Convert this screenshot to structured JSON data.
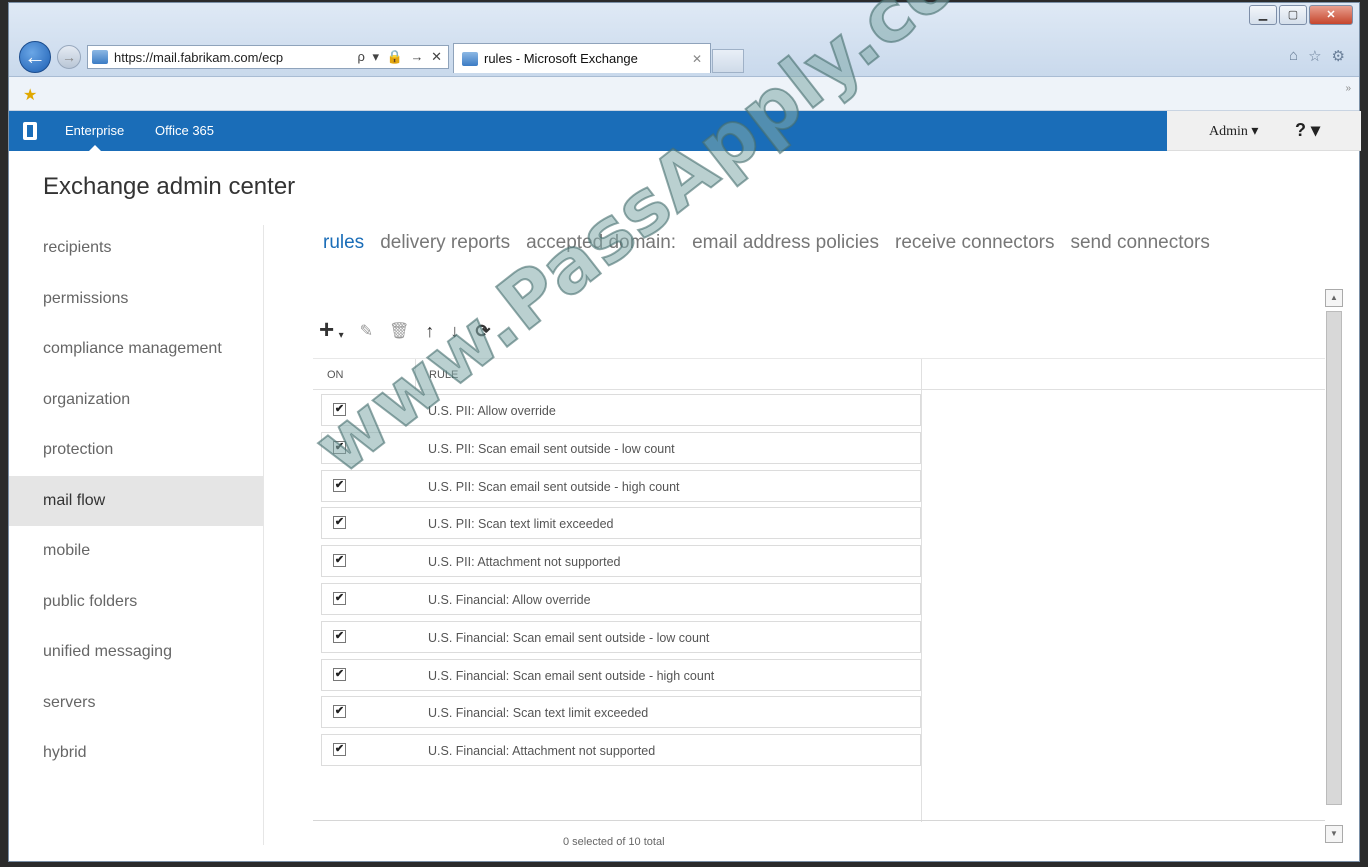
{
  "browser": {
    "url": "https://mail.fabrikam.com/ecp",
    "address_tools": "ρ ▾ 🔒 → ✕",
    "tab_title": "rules - Microsoft Exchange",
    "tab_close": "✕"
  },
  "window_controls": {
    "minimize": "▁",
    "maximize": "▢",
    "close": "✕"
  },
  "o365": {
    "links": [
      "Enterprise",
      "Office 365"
    ],
    "active": "Enterprise",
    "admin": "Admin ▾",
    "help": "? ▾"
  },
  "page_title": "Exchange admin center",
  "sidebar": {
    "items": [
      "recipients",
      "permissions",
      "compliance management",
      "organization",
      "protection",
      "mail flow",
      "mobile",
      "public folders",
      "unified messaging",
      "servers",
      "hybrid"
    ],
    "active": "mail flow"
  },
  "subtabs": {
    "items": [
      "rules",
      "delivery reports",
      "accepted domain:",
      "email address policies",
      "receive connectors",
      "send connectors"
    ],
    "active": "rules"
  },
  "toolbar": {
    "add": "+",
    "add_dropdown": "▾",
    "edit": "✎",
    "delete": "🗑",
    "move_up": "↑",
    "move_down": "↓",
    "refresh": "⟳"
  },
  "table": {
    "columns": [
      "ON",
      "RULE"
    ],
    "rows": [
      {
        "on": true,
        "rule": "U.S. PII: Allow override"
      },
      {
        "on": true,
        "rule": "U.S. PII: Scan email sent outside - low count"
      },
      {
        "on": true,
        "rule": "U.S. PII: Scan email sent outside - high count"
      },
      {
        "on": true,
        "rule": "U.S. PII: Scan text limit exceeded"
      },
      {
        "on": true,
        "rule": "U.S. PII: Attachment not supported"
      },
      {
        "on": true,
        "rule": "U.S. Financial: Allow override"
      },
      {
        "on": true,
        "rule": "U.S. Financial: Scan email sent outside - low count"
      },
      {
        "on": true,
        "rule": "U.S. Financial: Scan email sent outside - high count"
      },
      {
        "on": true,
        "rule": "U.S. Financial: Scan text limit exceeded"
      },
      {
        "on": true,
        "rule": "U.S. Financial: Attachment not supported"
      }
    ],
    "check_glyph": "✔",
    "status": "0 selected of 10 total"
  },
  "scrollbar": {
    "up": "▲",
    "down": "▼"
  },
  "watermark": "www.PassApply.com",
  "colors": {
    "o365_blue": "#1a6db8",
    "active_tab": "#1a6db8",
    "sidebar_active_bg": "#e5e5e5"
  }
}
